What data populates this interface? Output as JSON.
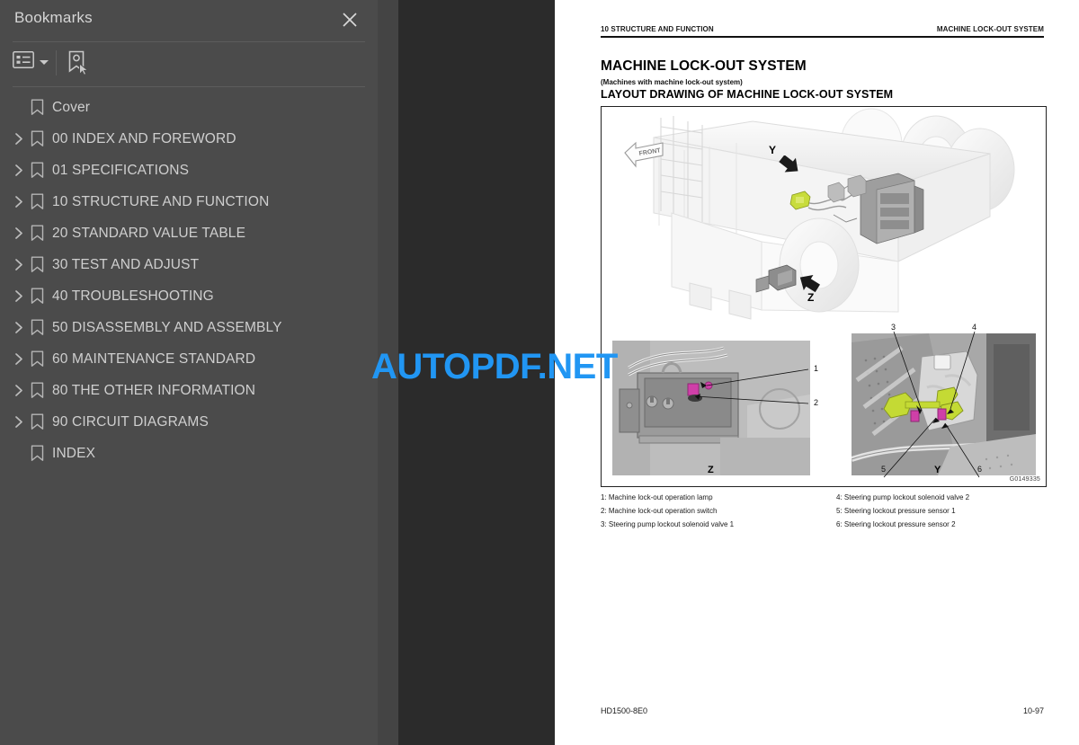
{
  "sidebar": {
    "title": "Bookmarks",
    "close_icon": "close-icon",
    "toolbar": {
      "options_icon": "list-options-icon",
      "caret_icon": "chevron-down-icon",
      "expand_current_icon": "bookmark-cursor-icon"
    },
    "items": [
      {
        "label": "Cover",
        "expandable": false
      },
      {
        "label": "00 INDEX AND FOREWORD",
        "expandable": true
      },
      {
        "label": "01 SPECIFICATIONS",
        "expandable": true
      },
      {
        "label": "10 STRUCTURE AND FUNCTION",
        "expandable": true
      },
      {
        "label": "20 STANDARD VALUE TABLE",
        "expandable": true
      },
      {
        "label": "30 TEST AND ADJUST",
        "expandable": true
      },
      {
        "label": "40 TROUBLESHOOTING",
        "expandable": true
      },
      {
        "label": "50 DISASSEMBLY AND ASSEMBLY",
        "expandable": true
      },
      {
        "label": "60 MAINTENANCE STANDARD",
        "expandable": true
      },
      {
        "label": "80 THE OTHER INFORMATION",
        "expandable": true
      },
      {
        "label": "90 CIRCUIT DIAGRAMS",
        "expandable": true
      },
      {
        "label": "INDEX",
        "expandable": false
      }
    ]
  },
  "document": {
    "running_head_left": "10 STRUCTURE AND FUNCTION",
    "running_head_right": "MACHINE LOCK-OUT SYSTEM",
    "title": "MACHINE LOCK-OUT SYSTEM",
    "subtitle": "(Machines with machine lock-out system)",
    "section": "LAYOUT DRAWING OF MACHINE LOCK-OUT SYSTEM",
    "figure": {
      "id": "G0149335",
      "front_arrow_label": "FRONT",
      "view_callouts": [
        "Y",
        "Z"
      ],
      "detail_labels": [
        "Z",
        "Y"
      ],
      "callout_numbers": [
        "1",
        "2",
        "3",
        "4",
        "5",
        "6"
      ]
    },
    "legend": {
      "column1": [
        "1: Machine lock-out operation lamp",
        "2: Machine lock-out operation switch",
        "3: Steering pump lockout solenoid valve 1"
      ],
      "column2": [
        "4: Steering pump lockout solenoid valve 2",
        "5: Steering lockout pressure sensor 1",
        "6: Steering lockout pressure sensor 2"
      ]
    },
    "footer_left": "HD1500-8E0",
    "footer_right": "10-97"
  },
  "watermark": {
    "text": "AUTOPDF.NET",
    "color": "#2196f3"
  }
}
